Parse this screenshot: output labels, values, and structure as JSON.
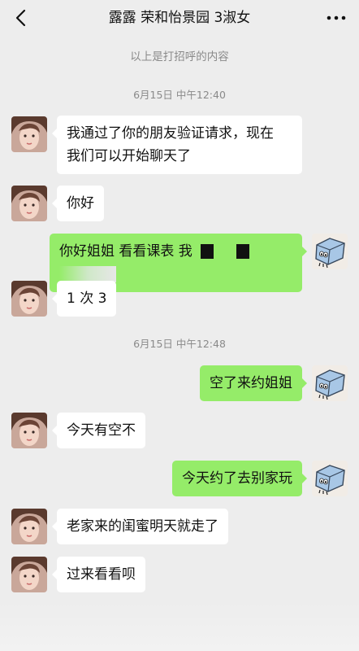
{
  "header": {
    "title": "露露 荣和怡景园 3淑女",
    "back_icon": "chevron-left-icon",
    "more_icon": "more-dots-icon"
  },
  "notice": "以上是打招呼的内容",
  "timestamps": [
    "6月15日 中午12:40",
    "6月15日 中午12:48"
  ],
  "messages": [
    {
      "dir": "in",
      "text": "我通过了你的朋友验证请求，现在\n我们可以开始聊天了"
    },
    {
      "dir": "in",
      "text": "你好"
    },
    {
      "dir": "out",
      "text": "你好姐姐 看看课表 我"
    },
    {
      "dir": "in",
      "text": "1 次 3"
    },
    {
      "dir": "out",
      "text": "空了来约姐姐"
    },
    {
      "dir": "in",
      "text": "今天有空不"
    },
    {
      "dir": "out",
      "text": "今天约了去别家玩"
    },
    {
      "dir": "in",
      "text": "老家来的闺蜜明天就走了"
    },
    {
      "dir": "in",
      "text": "过来看看呗"
    }
  ],
  "colors": {
    "background": "#ededed",
    "incoming_bubble": "#ffffff",
    "outgoing_bubble": "#95ec69",
    "meta_text": "#8a8a8a"
  }
}
